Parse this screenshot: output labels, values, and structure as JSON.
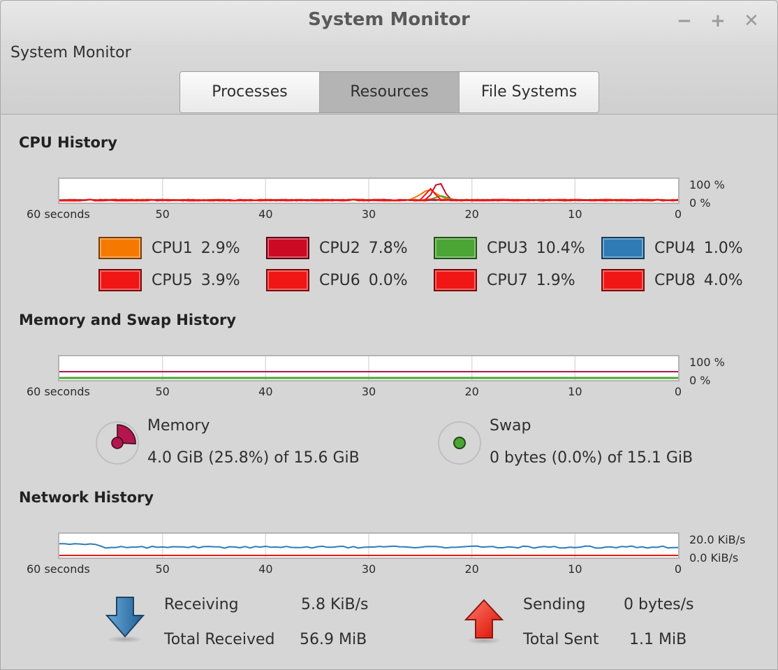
{
  "window": {
    "title": "System Monitor",
    "controls": [
      "minimize",
      "maximize",
      "close"
    ],
    "control_glyphs": {
      "minimize": "−",
      "maximize": "+",
      "close": "✕"
    }
  },
  "header": {
    "app_title": "System Monitor",
    "tabs": [
      {
        "label": "Processes",
        "active": false
      },
      {
        "label": "Resources",
        "active": true
      },
      {
        "label": "File Systems",
        "active": false
      }
    ]
  },
  "x_axis": {
    "labels": [
      "60 seconds",
      "50",
      "40",
      "30",
      "20",
      "10",
      "0"
    ]
  },
  "cpu": {
    "title": "CPU History",
    "y_labels": {
      "max": "100 %",
      "min": "0 %"
    },
    "cores": [
      {
        "name": "CPU1",
        "value": "2.9%",
        "color": "#f57900",
        "border": "#7a3c00"
      },
      {
        "name": "CPU2",
        "value": "7.8%",
        "color": "#cc0a24",
        "border": "#5a0010"
      },
      {
        "name": "CPU3",
        "value": "10.4%",
        "color": "#4aa535",
        "border": "#24521a"
      },
      {
        "name": "CPU4",
        "value": "1.0%",
        "color": "#2f7bb6",
        "border": "#173d5b"
      },
      {
        "name": "CPU5",
        "value": "3.9%",
        "color": "#f01616",
        "border": "#780b0b"
      },
      {
        "name": "CPU6",
        "value": "0.0%",
        "color": "#f01616",
        "border": "#780b0b"
      },
      {
        "name": "CPU7",
        "value": "1.9%",
        "color": "#f01616",
        "border": "#780b0b"
      },
      {
        "name": "CPU8",
        "value": "4.0%",
        "color": "#f01616",
        "border": "#780b0b"
      }
    ]
  },
  "memory": {
    "title": "Memory and Swap History",
    "y_labels": {
      "max": "100 %",
      "min": "0 %"
    },
    "memory_label": "Memory",
    "memory_value": "4.0 GiB (25.8%) of 15.6 GiB",
    "memory_fraction": 0.258,
    "memory_color": "#b3164f",
    "swap_label": "Swap",
    "swap_value": "0 bytes (0.0%) of 15.1 GiB",
    "swap_fraction": 0.0,
    "swap_color": "#4aa535"
  },
  "network": {
    "title": "Network History",
    "y_labels": {
      "max": "20.0 KiB/s",
      "min": "0.0 KiB/s"
    },
    "receiving_label": "Receiving",
    "receiving_value": "5.8 KiB/s",
    "total_received_label": "Total Received",
    "total_received_value": "56.9 MiB",
    "sending_label": "Sending",
    "sending_value": "0 bytes/s",
    "total_sent_label": "Total Sent",
    "total_sent_value": "1.1 MiB",
    "receive_color": "#2f7bb6",
    "send_color": "#e8160c"
  }
}
